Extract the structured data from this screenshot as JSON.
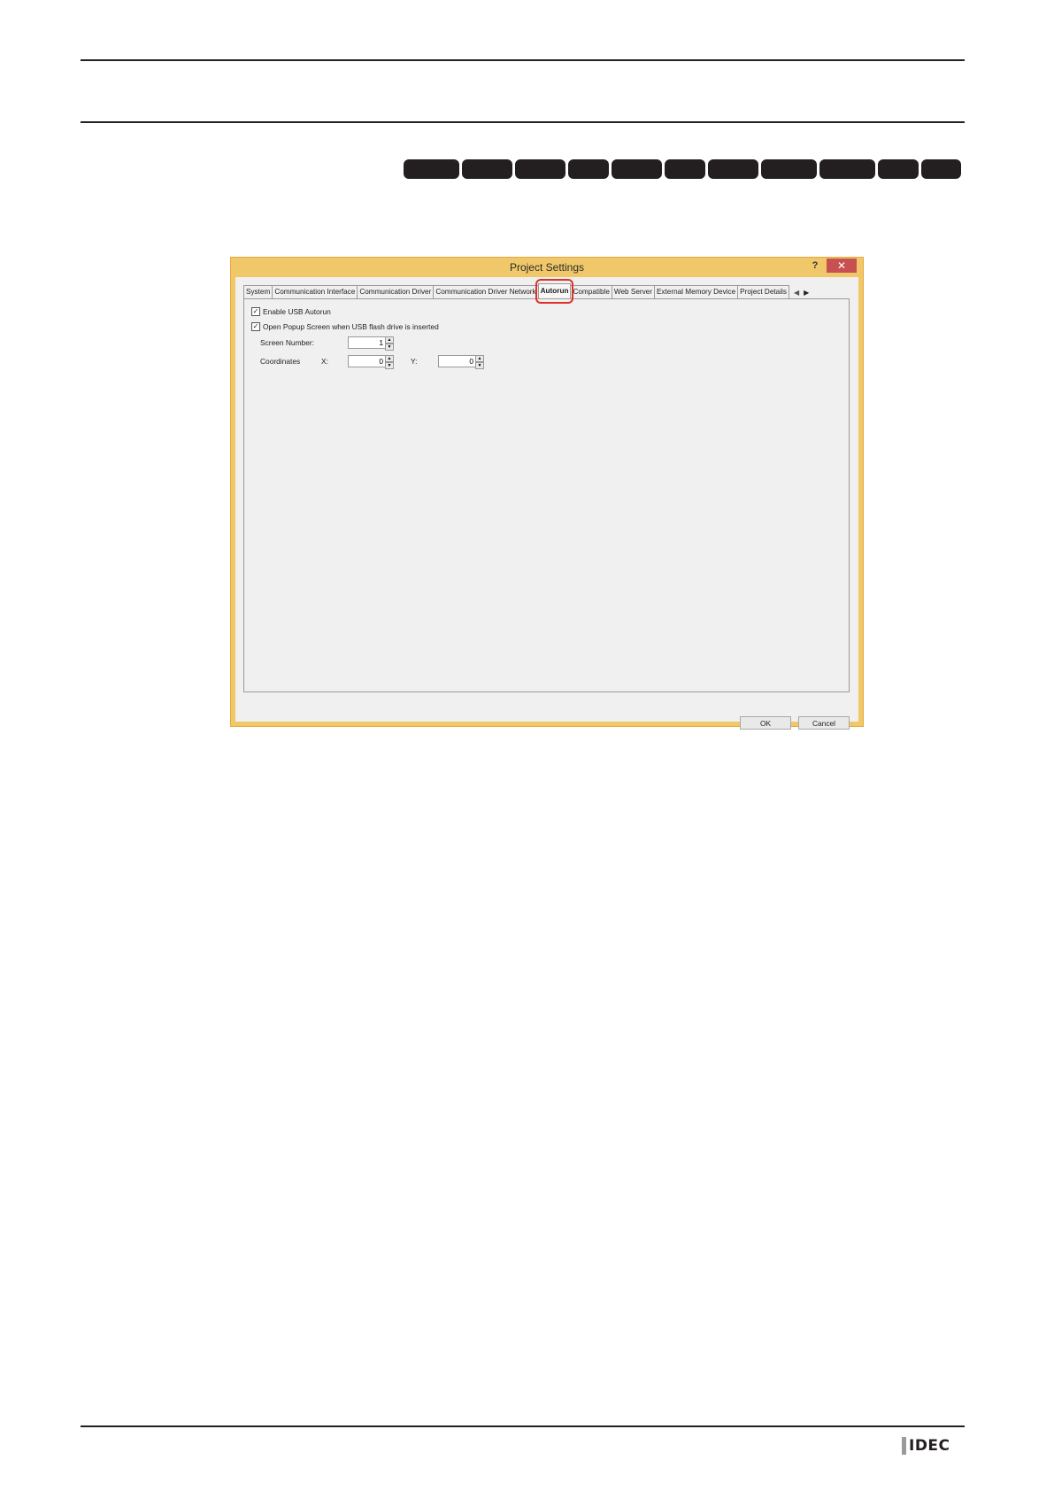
{
  "dialog": {
    "title": "Project Settings",
    "help": "?",
    "close": "✕",
    "tabs": [
      "System",
      "Communication Interface",
      "Communication Driver",
      "Communication Driver Network",
      "Autorun",
      "Compatible",
      "Web Server",
      "External Memory Device",
      "Project Details"
    ],
    "active_tab": "Autorun",
    "options": {
      "enable_usb_autorun": {
        "label": "Enable USB Autorun",
        "checked": true
      },
      "open_popup": {
        "label": "Open Popup Screen when USB flash drive is inserted",
        "checked": true
      }
    },
    "screen_number": {
      "label": "Screen Number:",
      "value": "1"
    },
    "coordinates": {
      "label": "Coordinates",
      "x_label": "X:",
      "x_value": "0",
      "y_label": "Y:",
      "y_value": "0"
    },
    "ok": "OK",
    "cancel": "Cancel"
  },
  "footer": {
    "logo": "IDEC"
  }
}
